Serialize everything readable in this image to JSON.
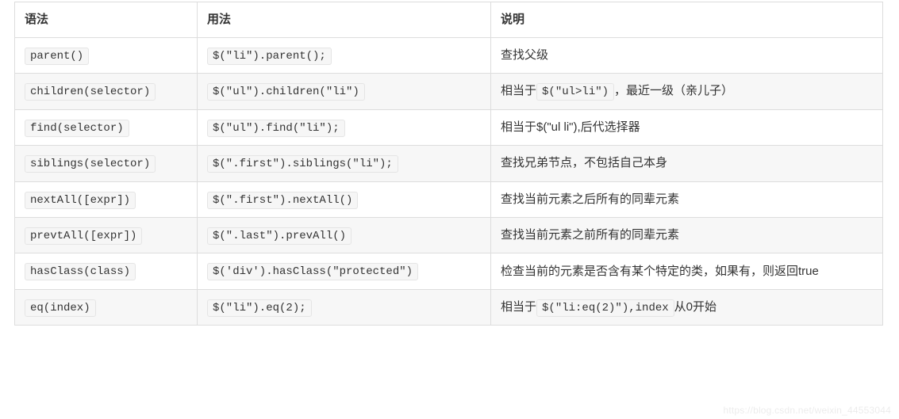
{
  "headers": [
    "语法",
    "用法",
    "说明"
  ],
  "rows": [
    {
      "syntax": "parent()",
      "usage": "$(\"li\").parent();",
      "desc": [
        {
          "t": "text",
          "v": "查找父级"
        }
      ]
    },
    {
      "syntax": "children(selector)",
      "usage": "$(\"ul\").children(\"li\")",
      "desc": [
        {
          "t": "text",
          "v": "相当于"
        },
        {
          "t": "code",
          "v": "$(\"ul>li\")"
        },
        {
          "t": "text",
          "v": "，最近一级（亲儿子）"
        }
      ]
    },
    {
      "syntax": "find(selector)",
      "usage": "$(\"ul\").find(\"li\");",
      "desc": [
        {
          "t": "text",
          "v": "相当于$(\"ul li\"),后代选择器"
        }
      ]
    },
    {
      "syntax": "siblings(selector)",
      "usage": "$(\".first\").siblings(\"li\");",
      "desc": [
        {
          "t": "text",
          "v": "查找兄弟节点，不包括自己本身"
        }
      ]
    },
    {
      "syntax": "nextAll([expr])",
      "usage": "$(\".first\").nextAll()",
      "desc": [
        {
          "t": "text",
          "v": "查找当前元素之后所有的同辈元素"
        }
      ]
    },
    {
      "syntax": "prevtAll([expr])",
      "usage": "$(\".last\").prevAll()",
      "desc": [
        {
          "t": "text",
          "v": "查找当前元素之前所有的同辈元素"
        }
      ]
    },
    {
      "syntax": "hasClass(class)",
      "usage": "$('div').hasClass(\"protected\")",
      "desc": [
        {
          "t": "text",
          "v": "检查当前的元素是否含有某个特定的类，如果有，则返回true"
        }
      ]
    },
    {
      "syntax": "eq(index)",
      "usage": "$(\"li\").eq(2);",
      "desc": [
        {
          "t": "text",
          "v": "相当于"
        },
        {
          "t": "code",
          "v": "$(\"li:eq(2)\"),index"
        },
        {
          "t": "text",
          "v": "从0开始"
        }
      ]
    }
  ],
  "watermark": "https://blog.csdn.net/weixin_44553044"
}
